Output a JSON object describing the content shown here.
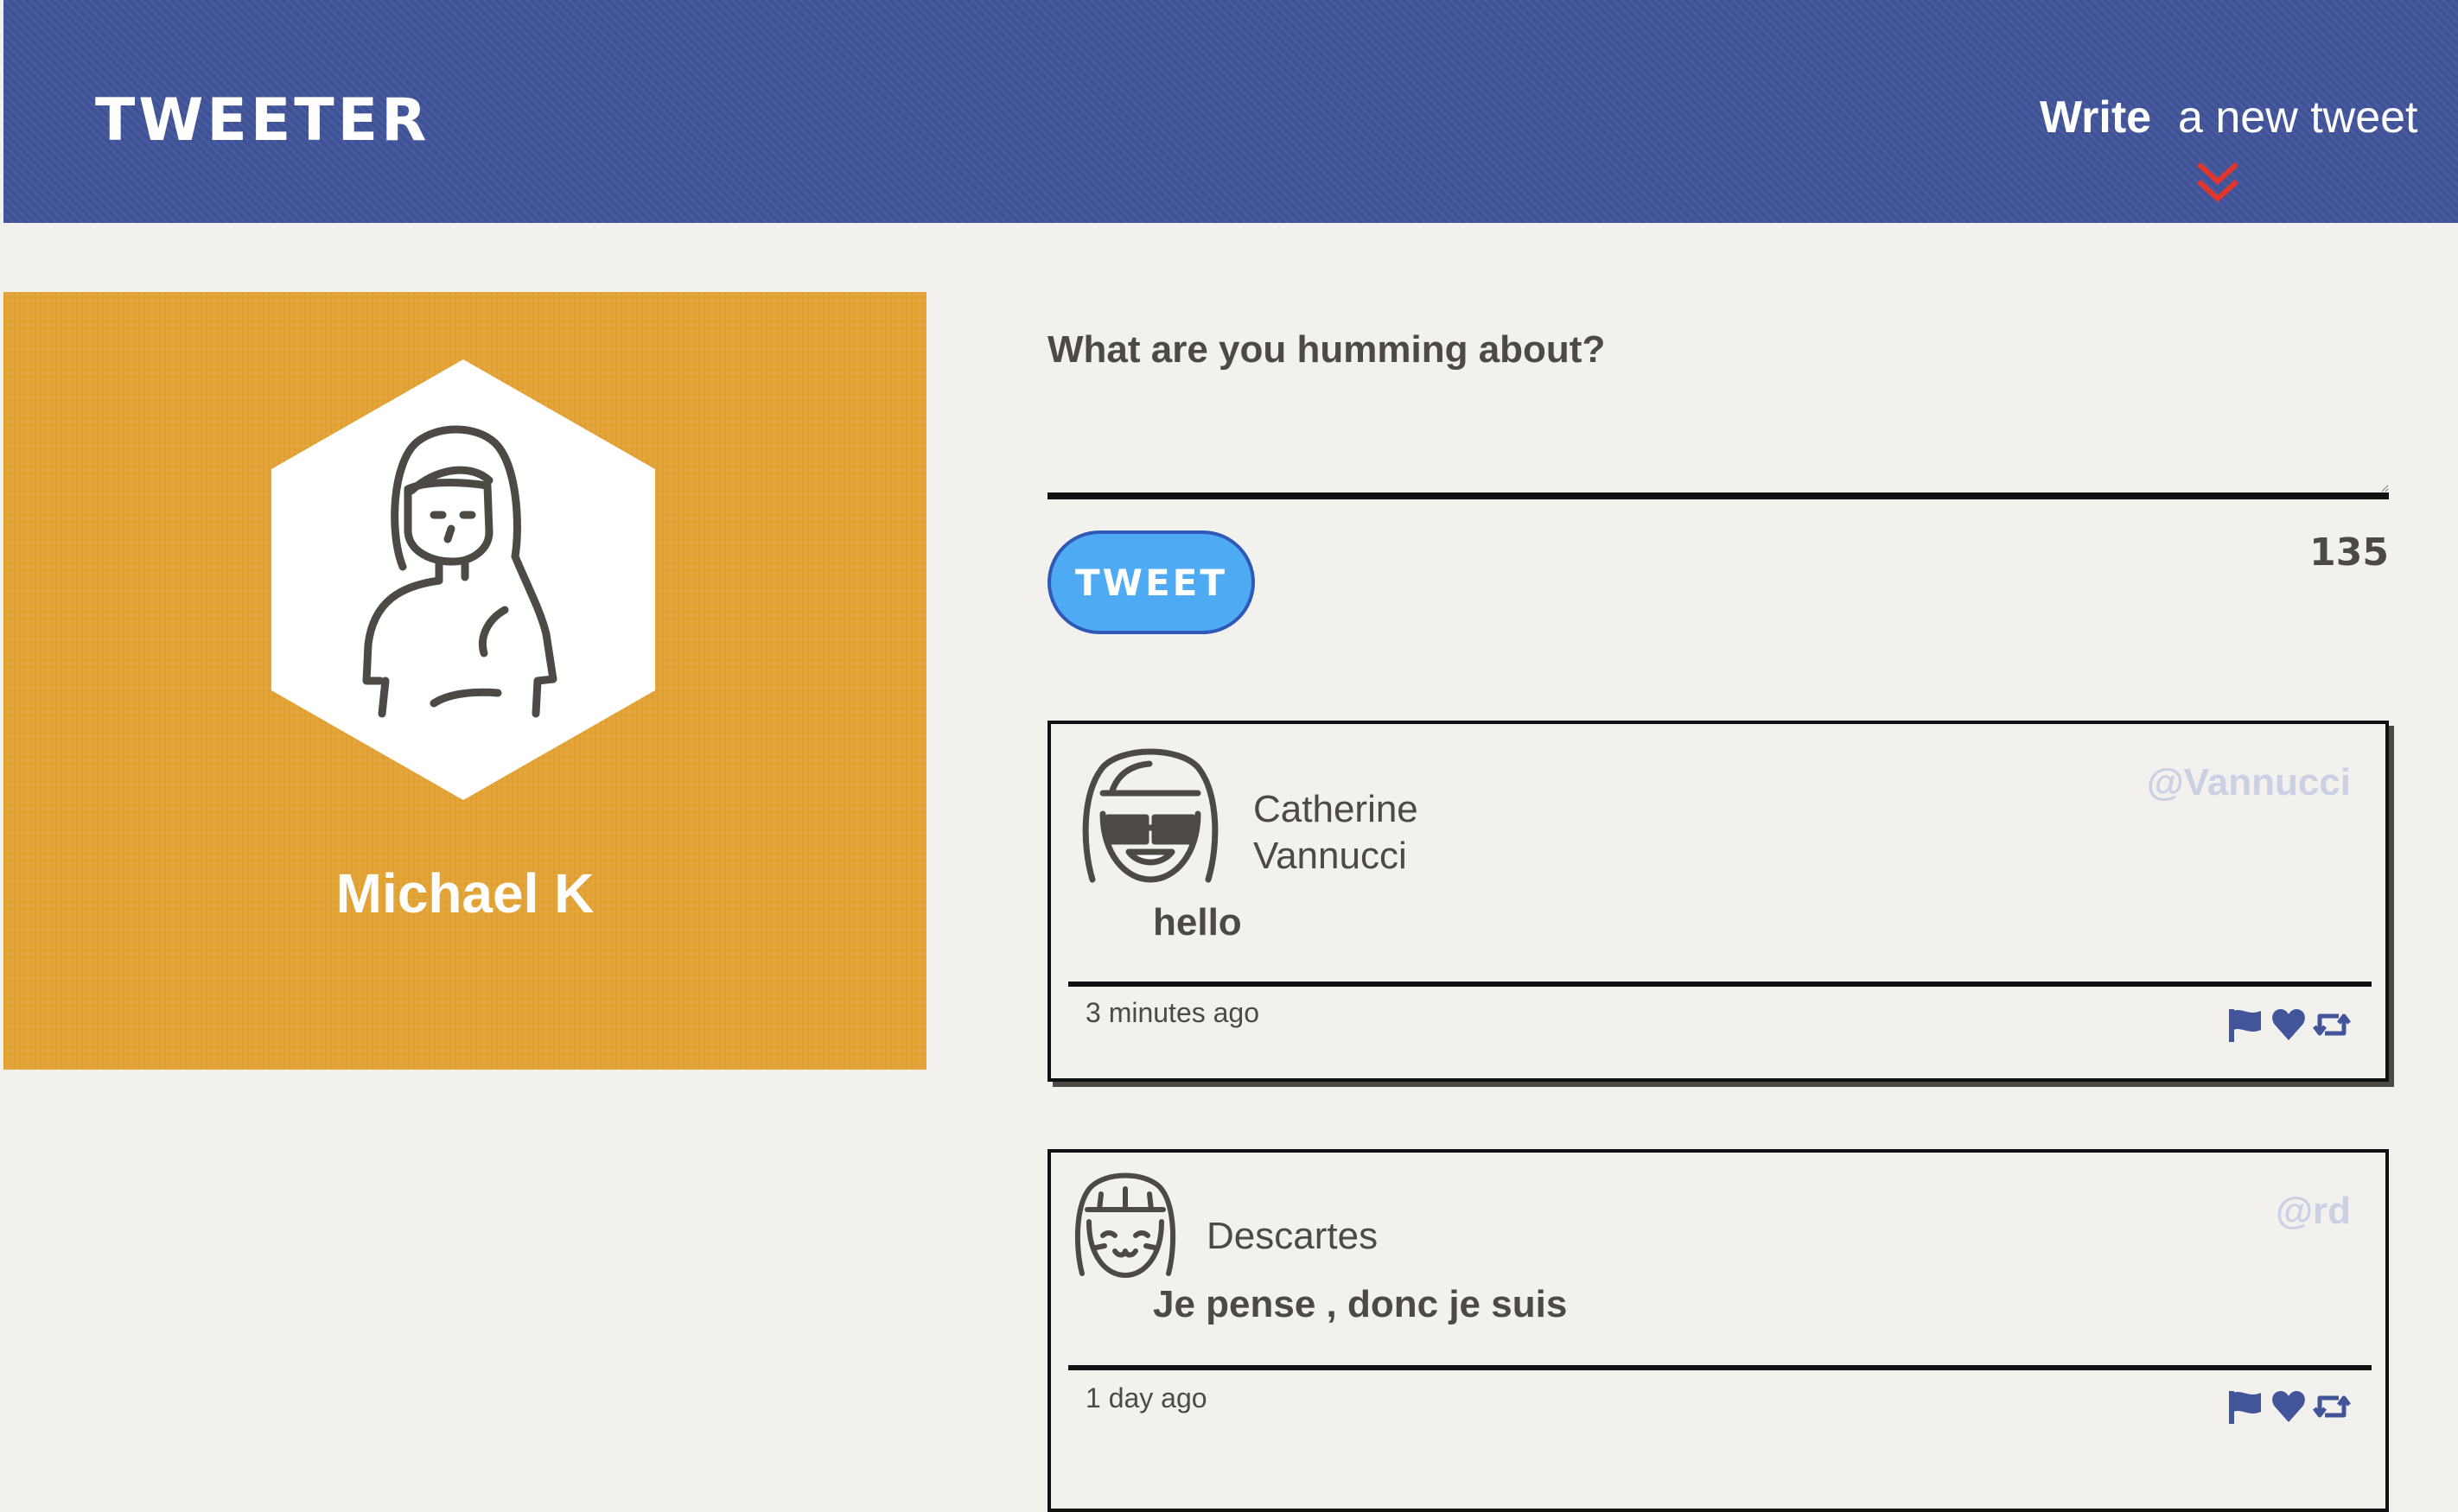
{
  "header": {
    "logo": "TWEETER",
    "compose_toggle": {
      "bold": "Write",
      "rest": "a new tweet"
    },
    "chevron_icon": "double-chevron-down-icon",
    "chevron_color": "#e4352b",
    "bg_color": "#42559b"
  },
  "profile": {
    "name": "Michael K",
    "bg_color": "#e4a335",
    "avatar_icon": "woman-avatar-icon"
  },
  "compose": {
    "label": "What are you humming about?",
    "value": "",
    "button_label": "TWEET",
    "counter": "135"
  },
  "tweets": [
    {
      "author_line1": "Catherine",
      "author_line2": "Vannucci",
      "handle": "@Vannucci",
      "content": "hello",
      "time": "3 minutes ago",
      "avatar_icon": "girl-sunglasses-avatar-icon"
    },
    {
      "author_line1": "Descartes",
      "handle": "@rd",
      "content": "Je pense , donc je suis",
      "time": "1 day ago",
      "avatar_icon": "girl-smiling-avatar-icon"
    }
  ],
  "action_icons": [
    "flag-icon",
    "heart-icon",
    "retweet-icon"
  ],
  "action_color": "#42559b"
}
